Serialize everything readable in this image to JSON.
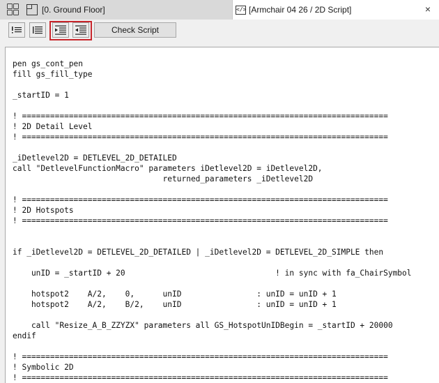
{
  "tabs": [
    {
      "label": "[0. Ground Floor]",
      "active": false,
      "icon": "floor-plan-icon"
    },
    {
      "label": "[Armchair 04 26 / 2D Script]",
      "active": true,
      "icon": "script-icon"
    }
  ],
  "tab_close": "×",
  "toolbar": {
    "buttons": [
      "insert-comment",
      "align-left",
      "indent",
      "outdent"
    ],
    "check_script_label": "Check Script",
    "highlight_color": "#c8252b"
  },
  "code_lines": [
    "pen gs_cont_pen",
    "fill gs_fill_type",
    "",
    "_startID = 1",
    "",
    "! ==============================================================================",
    "! 2D Detail Level",
    "! ==============================================================================",
    "",
    "_iDetlevel2D = DETLEVEL_2D_DETAILED",
    "call \"DetlevelFunctionMacro\" parameters iDetlevel2D = iDetlevel2D,",
    "                                returned_parameters _iDetlevel2D",
    "",
    "! ==============================================================================",
    "! 2D Hotspots",
    "! ==============================================================================",
    "",
    "",
    "if _iDetlevel2D = DETLEVEL_2D_DETAILED | _iDetlevel2D = DETLEVEL_2D_SIMPLE then",
    "",
    "    unID = _startID + 20                                ! in sync with fa_ChairSymbol",
    "",
    "    hotspot2    A/2,    0,      unID                : unID = unID + 1",
    "    hotspot2    A/2,    B/2,    unID                : unID = unID + 1",
    "",
    "    call \"Resize_A_B_ZZYZX\" parameters all GS_HotspotUnIDBegin = _startID + 20000",
    "endif",
    "",
    "! ==============================================================================",
    "! Symbolic 2D",
    "! =============================================================================="
  ]
}
